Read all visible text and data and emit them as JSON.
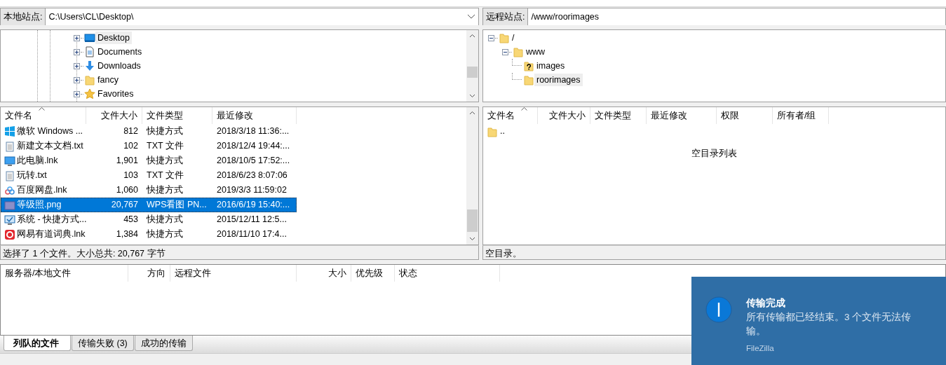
{
  "local_site": {
    "label": "本地站点:",
    "path": "C:\\Users\\CL\\Desktop\\"
  },
  "local_tree": [
    {
      "name": "Desktop",
      "kind": "desktop",
      "expanded": false,
      "selected": true
    },
    {
      "name": "Documents",
      "kind": "document",
      "expanded": false,
      "selected": false
    },
    {
      "name": "Downloads",
      "kind": "download",
      "expanded": false,
      "selected": false
    },
    {
      "name": "fancy",
      "kind": "folder",
      "expanded": false,
      "selected": false
    },
    {
      "name": "Favorites",
      "kind": "star",
      "expanded": false,
      "selected": false
    }
  ],
  "remote_site": {
    "label": "远程站点:",
    "path": "/www/roorimages"
  },
  "remote_tree": [
    {
      "name": "/",
      "kind": "folder",
      "expanded": true,
      "selected": false,
      "children": [
        {
          "name": "www",
          "kind": "folder",
          "expanded": true,
          "selected": false,
          "children": [
            {
              "name": "images",
              "kind": "unknown",
              "selected": false
            },
            {
              "name": "roorimages",
              "kind": "folder",
              "selected": true
            }
          ]
        }
      ]
    }
  ],
  "local_files": {
    "columns": [
      {
        "label": "文件名",
        "sorted": true
      },
      {
        "label": "文件大小",
        "sorted": false
      },
      {
        "label": "文件类型",
        "sorted": false
      },
      {
        "label": "最近修改",
        "sorted": false
      }
    ],
    "rows": [
      {
        "name": "微软 Windows ...",
        "kind": "app",
        "size": "812",
        "type": "快捷方式",
        "modified": "2018/3/18 11:36:...",
        "selected": false
      },
      {
        "name": "新建文本文档.txt",
        "kind": "text",
        "size": "102",
        "type": "TXT 文件",
        "modified": "2018/12/4 19:44:...",
        "selected": false
      },
      {
        "name": "此电脑.lnk",
        "kind": "computer",
        "size": "1,901",
        "type": "快捷方式",
        "modified": "2018/10/5 17:52:...",
        "selected": false
      },
      {
        "name": "玩转.txt",
        "kind": "text",
        "size": "103",
        "type": "TXT 文件",
        "modified": "2018/6/23 8:07:06",
        "selected": false
      },
      {
        "name": "百度网盘.lnk",
        "kind": "cloud",
        "size": "1,060",
        "type": "快捷方式",
        "modified": "2019/3/3 11:59:02",
        "selected": false
      },
      {
        "name": "等级照.png",
        "kind": "image",
        "size": "20,767",
        "type": "WPS看图 PN...",
        "modified": "2016/6/19 15:40:...",
        "selected": true
      },
      {
        "name": "系统 - 快捷方式...",
        "kind": "monitor",
        "size": "453",
        "type": "快捷方式",
        "modified": "2015/12/11 12:5...",
        "selected": false
      },
      {
        "name": "网易有道词典.lnk",
        "kind": "dict",
        "size": "1,384",
        "type": "快捷方式",
        "modified": "2018/11/10 17:4...",
        "selected": false
      }
    ],
    "status": "选择了 1 个文件。大小总共: 20,767 字节"
  },
  "remote_files": {
    "columns": [
      {
        "label": "文件名",
        "sorted": true
      },
      {
        "label": "文件大小",
        "sorted": false
      },
      {
        "label": "文件类型",
        "sorted": false
      },
      {
        "label": "最近修改",
        "sorted": false
      },
      {
        "label": "权限",
        "sorted": false
      },
      {
        "label": "所有者/组",
        "sorted": false
      }
    ],
    "rows": [
      {
        "name": "..",
        "kind": "folder",
        "selected": false
      }
    ],
    "empty_message": "空目录列表",
    "status": "空目录。"
  },
  "queue": {
    "columns": [
      "服务器/本地文件",
      "方向",
      "远程文件",
      "大小",
      "优先级",
      "状态"
    ]
  },
  "queue_tabs": [
    {
      "label": "列队的文件",
      "selected": true
    },
    {
      "label": "传输失败 (3)",
      "selected": false
    },
    {
      "label": "成功的传输",
      "selected": false
    }
  ],
  "notification": {
    "title": "传输完成",
    "message": "所有传输都已经结束。3 个文件无法传输。",
    "source": "FileZilla"
  }
}
